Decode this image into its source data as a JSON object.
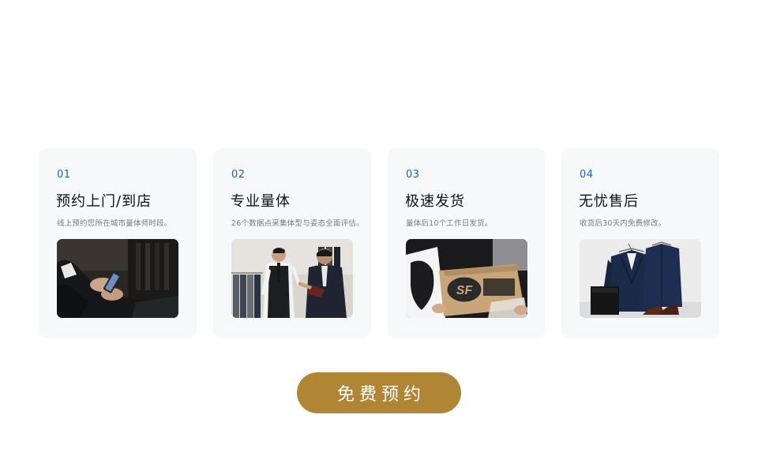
{
  "steps": [
    {
      "num": "01",
      "title": "预约上门/到店",
      "desc": "线上预约您所在城市量体师时段。"
    },
    {
      "num": "02",
      "title": "专业量体",
      "desc": "26个数据点采集体型与姿态全面评估。"
    },
    {
      "num": "03",
      "title": "极速发货",
      "desc": "量体后10个工作日发货。",
      "box_logo": "SF"
    },
    {
      "num": "04",
      "title": "无忧售后",
      "desc": "收货后30天内免费修改。"
    }
  ],
  "cta": {
    "label": "免费预约"
  },
  "colors": {
    "accent_blue": "#1a63b8",
    "cta_gold": "#b08534",
    "card_bg": "#f7f8fa"
  }
}
